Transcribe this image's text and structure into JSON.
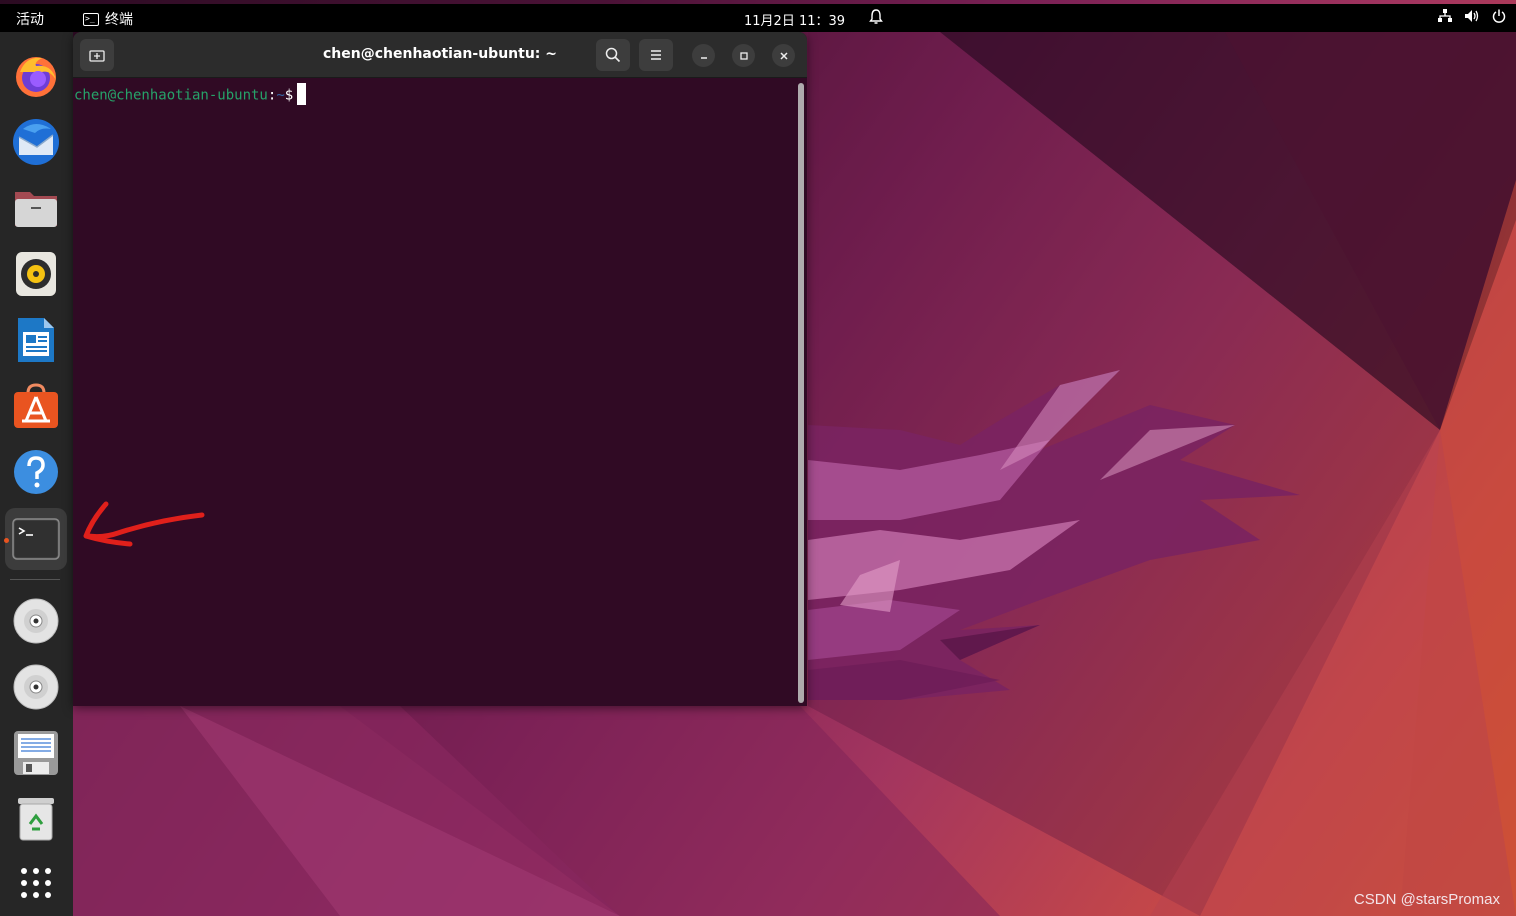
{
  "topbar": {
    "activities": "活动",
    "app_name": "终端",
    "app_icon": "terminal-icon",
    "clock": "11月2日  11：39",
    "icons": [
      "bell-icon",
      "network-icon",
      "volume-icon",
      "power-icon"
    ]
  },
  "dock": {
    "items": [
      "firefox-icon",
      "thunderbird-icon",
      "files-icon",
      "rhythmbox-icon",
      "libreoffice-writer-icon",
      "app-center-icon",
      "help-icon",
      "terminal-icon",
      "disc-icon",
      "disc-icon",
      "floppy-save-icon",
      "trash-icon",
      "show-apps-icon"
    ],
    "active_item": "terminal-icon"
  },
  "terminal": {
    "title": "chen@chenhaotian-ubuntu: ~",
    "prompt_user": "chen@chenhaotian-ubuntu",
    "prompt_sep": ":",
    "prompt_path": "~",
    "prompt_dollar": "$",
    "background_color": "#300a24",
    "prompt_color": "#26a269"
  },
  "watermark": "CSDN @starsPromax",
  "colors": {
    "accent": "#e95420",
    "annotation": "#e0201b"
  }
}
